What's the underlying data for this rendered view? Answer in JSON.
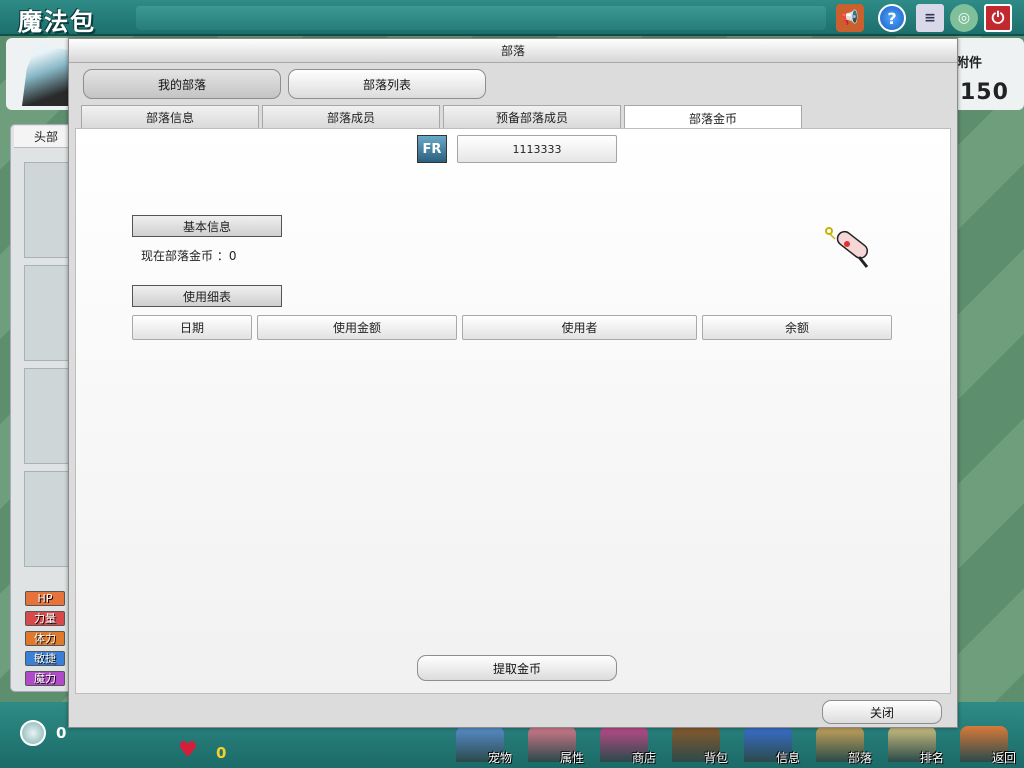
{
  "app": {
    "title": "魔法包"
  },
  "background_panel": {
    "side_tab": "头部",
    "stats": [
      {
        "label": "HP",
        "color": "#e8733a"
      },
      {
        "label": "力量",
        "color": "#d84a4a"
      },
      {
        "label": "体力",
        "color": "#e07a2a"
      },
      {
        "label": "敏捷",
        "color": "#3a7fd8"
      },
      {
        "label": "魔力",
        "color": "#b04ac8"
      }
    ],
    "right_label": "附件",
    "right_count": "150"
  },
  "bottom_bar": {
    "coin_count": "0",
    "heart_count": "0",
    "nav": [
      {
        "label": "宠物",
        "icon": "pet-icon",
        "color": "#5a8fd0"
      },
      {
        "label": "属性",
        "icon": "attribute-icon",
        "color": "#d77a8a"
      },
      {
        "label": "商店",
        "icon": "shop-icon",
        "color": "#c04a8a"
      },
      {
        "label": "背包",
        "icon": "bag-icon",
        "color": "#8a5a2a"
      },
      {
        "label": "信息",
        "icon": "info-icon",
        "color": "#3a6fd0"
      },
      {
        "label": "部落",
        "icon": "tribe-icon",
        "color": "#c9a55a"
      },
      {
        "label": "排名",
        "icon": "ranking-icon",
        "color": "#d0c080"
      },
      {
        "label": "返回",
        "icon": "return-icon",
        "color": "#d87a3a"
      }
    ]
  },
  "dialog": {
    "title": "部落",
    "top_buttons": {
      "my_tribe": "我的部落",
      "tribe_list": "部落列表"
    },
    "tabs": [
      "部落信息",
      "部落成员",
      "预备部落成员",
      "部落金币"
    ],
    "selected_tab": 3,
    "tribe_id": "1113333",
    "basic_info_header": "基本信息",
    "current_gold_label": "现在部落金币 ：0",
    "usage_header": "使用细表",
    "columns": [
      "日期",
      "使用金额",
      "使用者",
      "余额"
    ],
    "withdraw_button": "提取金币",
    "close_button": "关闭"
  }
}
